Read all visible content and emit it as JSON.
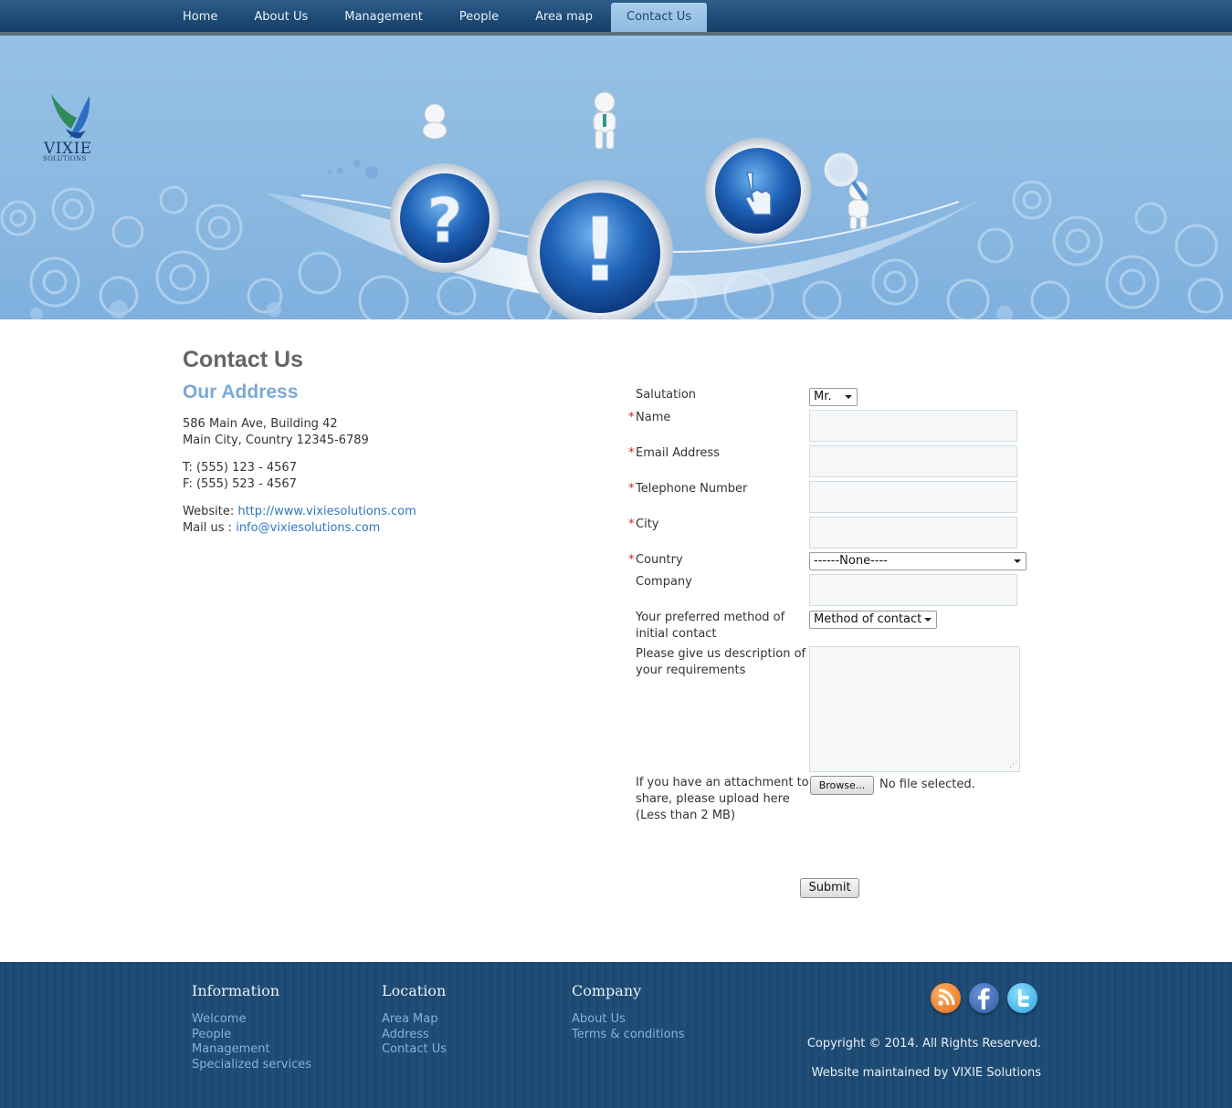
{
  "nav": {
    "tabs": [
      "Home",
      "About Us",
      "Management",
      "People",
      "Area map",
      "Contact Us"
    ],
    "active_tab": "Contact Us"
  },
  "logo": {
    "name": "VIXIE",
    "subtitle": "SOLUTIONS"
  },
  "page": {
    "title": "Contact Us"
  },
  "address": {
    "title": "Our Address",
    "line1": "586 Main Ave, Building 42",
    "line2": "Main City, Country 12345-6789",
    "phone": "T: (555) 123 - 4567",
    "fax": "F: (555) 523 - 4567",
    "website_label": "Website: ",
    "website_url": "http://www.vixiesolutions.com",
    "mail_label": "Mail us  : ",
    "mail": "info@vixiesolutions.com"
  },
  "form": {
    "required_mark": "*",
    "salutation_label": "Salutation",
    "salutation_value": "Mr.",
    "name_label": "Name",
    "email_label": "Email Address",
    "phone_label": "Telephone Number",
    "city_label": "City",
    "country_label": "Country",
    "country_value": "------None----",
    "company_label": "Company",
    "method_label_1": "Your preferred method of",
    "method_label_2": "initial contact",
    "method_value": "Method of contact",
    "desc_label_1": "Please give us description of",
    "desc_label_2": "your requirements",
    "attach_label_1": "If you have an attachment to",
    "attach_label_2": "share, please upload here",
    "attach_label_3": "(Less than 2 MB)",
    "browse_label": "Browse...",
    "no_file": "No file selected.",
    "submit_label": "Submit"
  },
  "footer": {
    "information": {
      "title": "Information",
      "links": [
        "Welcome",
        "People",
        "Management",
        "Specialized services"
      ]
    },
    "location": {
      "title": "Location",
      "links": [
        "Area Map",
        "Address",
        "Contact Us"
      ]
    },
    "company": {
      "title": "Company",
      "links": [
        "About Us",
        "Terms & conditions"
      ]
    },
    "copyright": "Copyright © 2014. All Rights Reserved.",
    "maintained": "Website maintained by VIXIE Solutions",
    "social": [
      "rss-icon",
      "facebook-icon",
      "twitter-icon"
    ]
  },
  "colors": {
    "nav_bg": "#1d4a74",
    "active_tab": "#a9cdea",
    "banner": "#8ab8e1",
    "link": "#2e78c2",
    "footer_bg": "#1d4a72",
    "footer_link": "#7fb3e2",
    "required": "#c0262d"
  }
}
